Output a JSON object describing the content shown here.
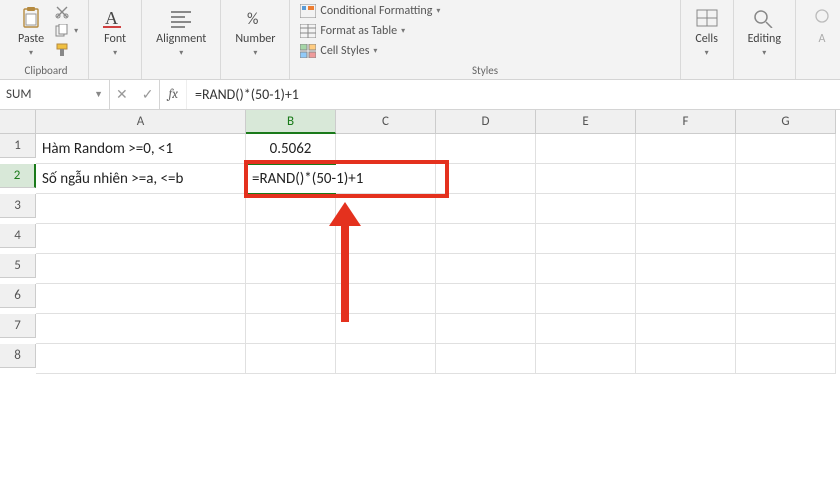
{
  "ribbon": {
    "clipboard": {
      "label": "Clipboard",
      "paste": "Paste"
    },
    "font": {
      "label": "Font"
    },
    "alignment": {
      "label": "Alignment"
    },
    "number": {
      "label": "Number"
    },
    "styles": {
      "label": "Styles",
      "cond": "Conditional Formatting",
      "table": "Format as Table",
      "cellstyles": "Cell Styles"
    },
    "cells": {
      "label": "Cells"
    },
    "editing": {
      "label": "Editing"
    }
  },
  "formula_bar": {
    "name_box": "SUM",
    "fx": "fx",
    "formula": "=RAND()*(50-1)+1"
  },
  "columns": [
    "A",
    "B",
    "C",
    "D",
    "E",
    "F",
    "G"
  ],
  "rows": [
    "1",
    "2",
    "3",
    "4",
    "5",
    "6",
    "7",
    "8"
  ],
  "cells": {
    "A1": "Hàm Random >=0, <1",
    "B1": "0.5062",
    "A2": "Số ngẫu nhiên >=a, <=b",
    "B2": "=RAND()*(50-1)+1"
  },
  "active_cell": "B2"
}
